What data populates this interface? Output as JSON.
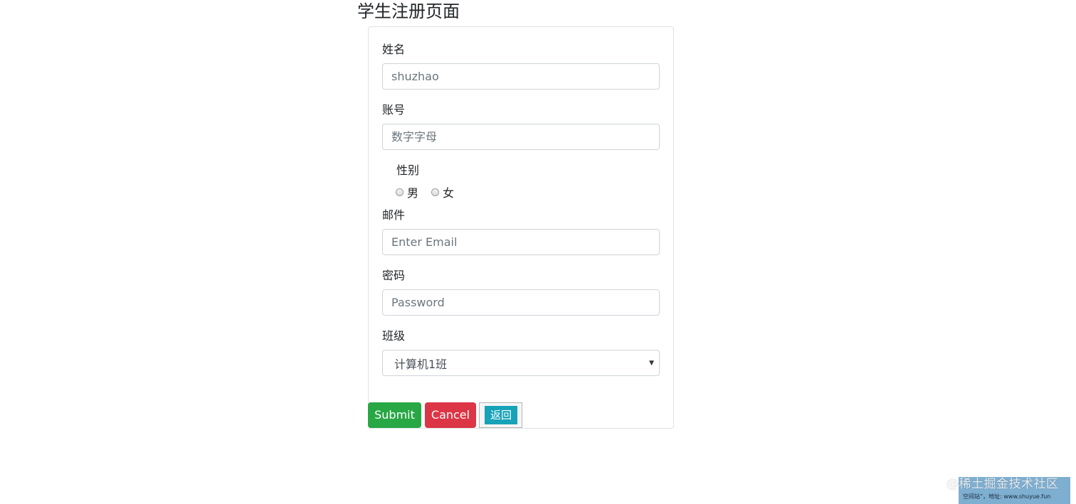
{
  "page": {
    "title": "学生注册页面"
  },
  "form": {
    "name": {
      "label": "姓名",
      "placeholder": "shuzhao"
    },
    "account": {
      "label": "账号",
      "placeholder": "数字字母"
    },
    "gender": {
      "label": "性别",
      "options": [
        "男",
        "女"
      ]
    },
    "email": {
      "label": "邮件",
      "placeholder": "Enter Email"
    },
    "password": {
      "label": "密码",
      "placeholder": "Password"
    },
    "class": {
      "label": "班级",
      "selected": "计算机1班"
    }
  },
  "buttons": {
    "submit": "Submit",
    "cancel": "Cancel",
    "back": "返回"
  },
  "watermark": {
    "overlay": "@稀土掘金技术社区",
    "line2": "空间站”，地址: www.shuyue.fun"
  },
  "colors": {
    "submit": "#28a745",
    "cancel": "#dc3545",
    "back": "#17a2b8"
  }
}
